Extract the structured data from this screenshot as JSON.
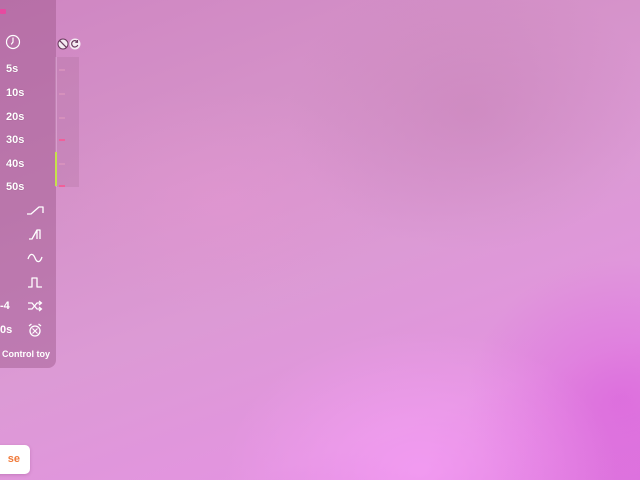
{
  "panel": {
    "times": [
      {
        "label": "5s"
      },
      {
        "label": "10s"
      },
      {
        "label": "20s"
      },
      {
        "label": "30s"
      },
      {
        "label": "40s"
      },
      {
        "label": "50s"
      }
    ],
    "patterns": [
      {
        "icon": "ramp-up-icon",
        "label": ""
      },
      {
        "icon": "step-ramp-icon",
        "label": ""
      },
      {
        "icon": "wave-icon",
        "label": ""
      },
      {
        "icon": "pulse-icon",
        "label": ""
      },
      {
        "icon": "shuffle-icon",
        "label": "-4"
      },
      {
        "icon": "alarm-icon",
        "label": "0s"
      }
    ],
    "control_label": "Control toy",
    "accent_color": "#c6e24b"
  },
  "bottom_button": {
    "label": "se",
    "text_color": "#f07a3a"
  }
}
